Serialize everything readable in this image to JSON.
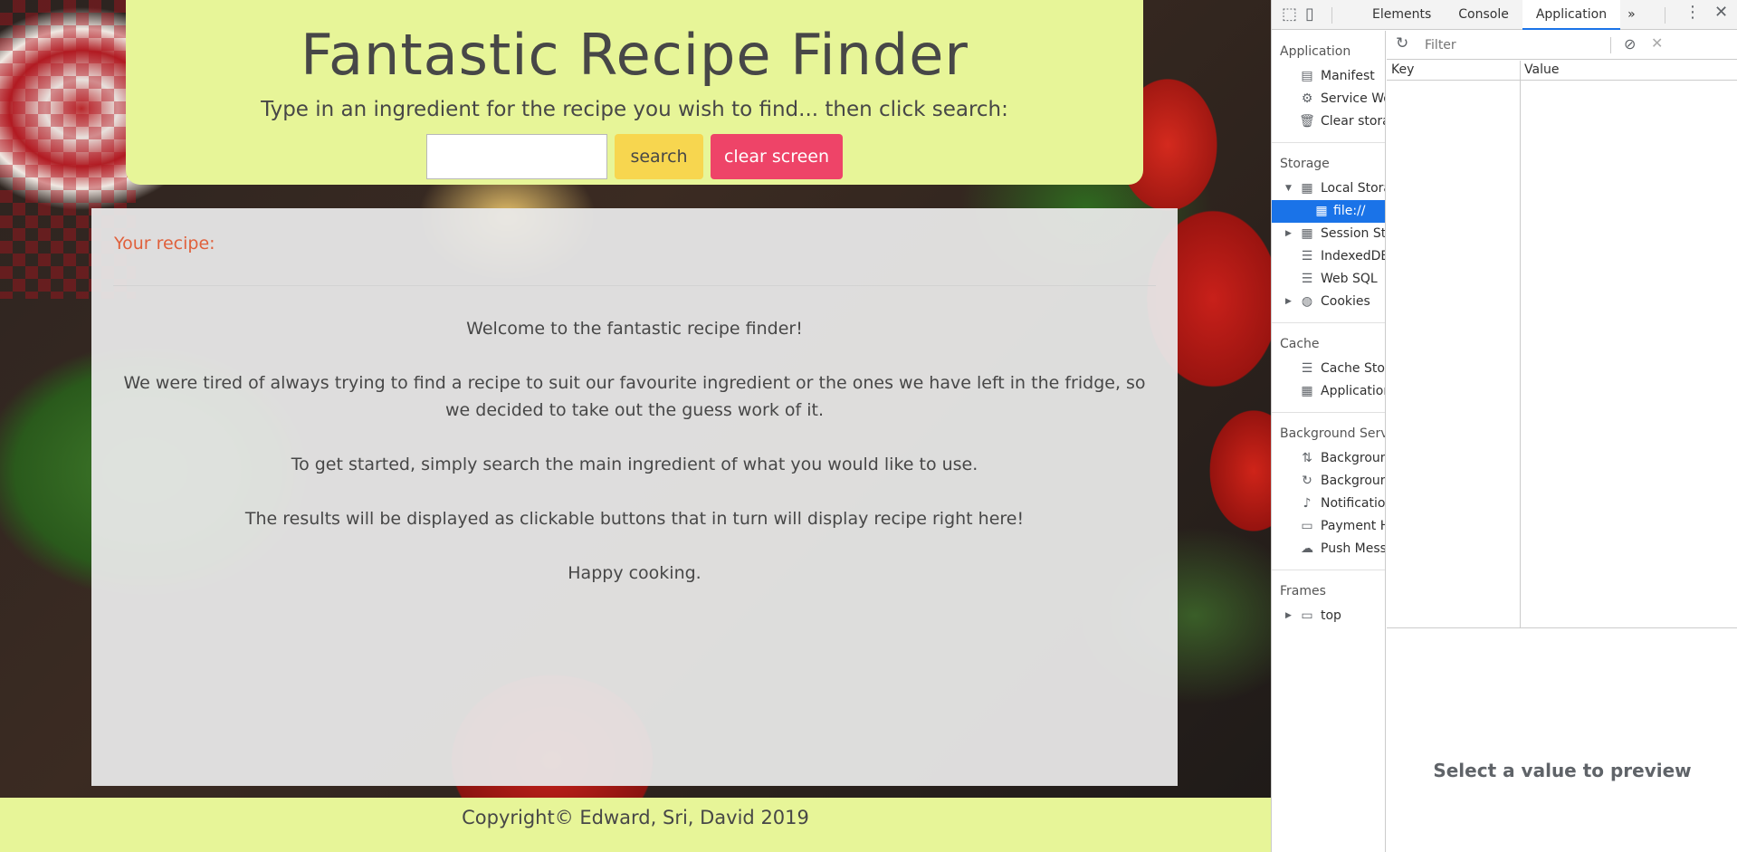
{
  "page": {
    "title": "Fantastic Recipe Finder",
    "instructions": "Type in an ingredient for the recipe you wish to find... then click search:",
    "search": {
      "value": "",
      "placeholder": "",
      "button_label": "search"
    },
    "clear_button_label": "clear screen",
    "recipe_heading": "Your recipe:",
    "welcome": [
      "Welcome to the fantastic recipe finder!",
      "We were tired of always trying to find a recipe to suit our favourite ingredient or the ones we have left in the fridge, so we decided to take out the guess work of it.",
      "To get started, simply search the main ingredient of what you would like to use.",
      "The results will be displayed as clickable buttons that in turn will display recipe right here!",
      "Happy cooking."
    ],
    "footer": "Copyright© Edward, Sri, David 2019",
    "colors": {
      "header_bg": "#e7f598",
      "search_button": "#f7d64f",
      "clear_button": "#ee4468",
      "heading_accent": "#e0603b"
    }
  },
  "devtools": {
    "tabs": [
      "Elements",
      "Console",
      "Application"
    ],
    "active_tab": "Application",
    "more_tabs_icon": "»",
    "sidebar": {
      "application_header": "Application",
      "application_items": [
        "Manifest",
        "Service Wo",
        "Clear stora"
      ],
      "storage_header": "Storage",
      "storage_items": [
        "Local Stora",
        "file://",
        "Session Sto",
        "IndexedDB",
        "Web SQL",
        "Cookies"
      ],
      "cache_header": "Cache",
      "cache_items": [
        "Cache Stor",
        "Applicatior"
      ],
      "background_header": "Background Servi",
      "background_items": [
        "Backgroun",
        "Backgroun",
        "Notificatior",
        "Payment H",
        "Push Mess"
      ],
      "frames_header": "Frames",
      "frames_items": [
        "top"
      ]
    },
    "filter_placeholder": "Filter",
    "table_headers": {
      "key": "Key",
      "value": "Value"
    },
    "preview_text": "Select a value to preview"
  }
}
